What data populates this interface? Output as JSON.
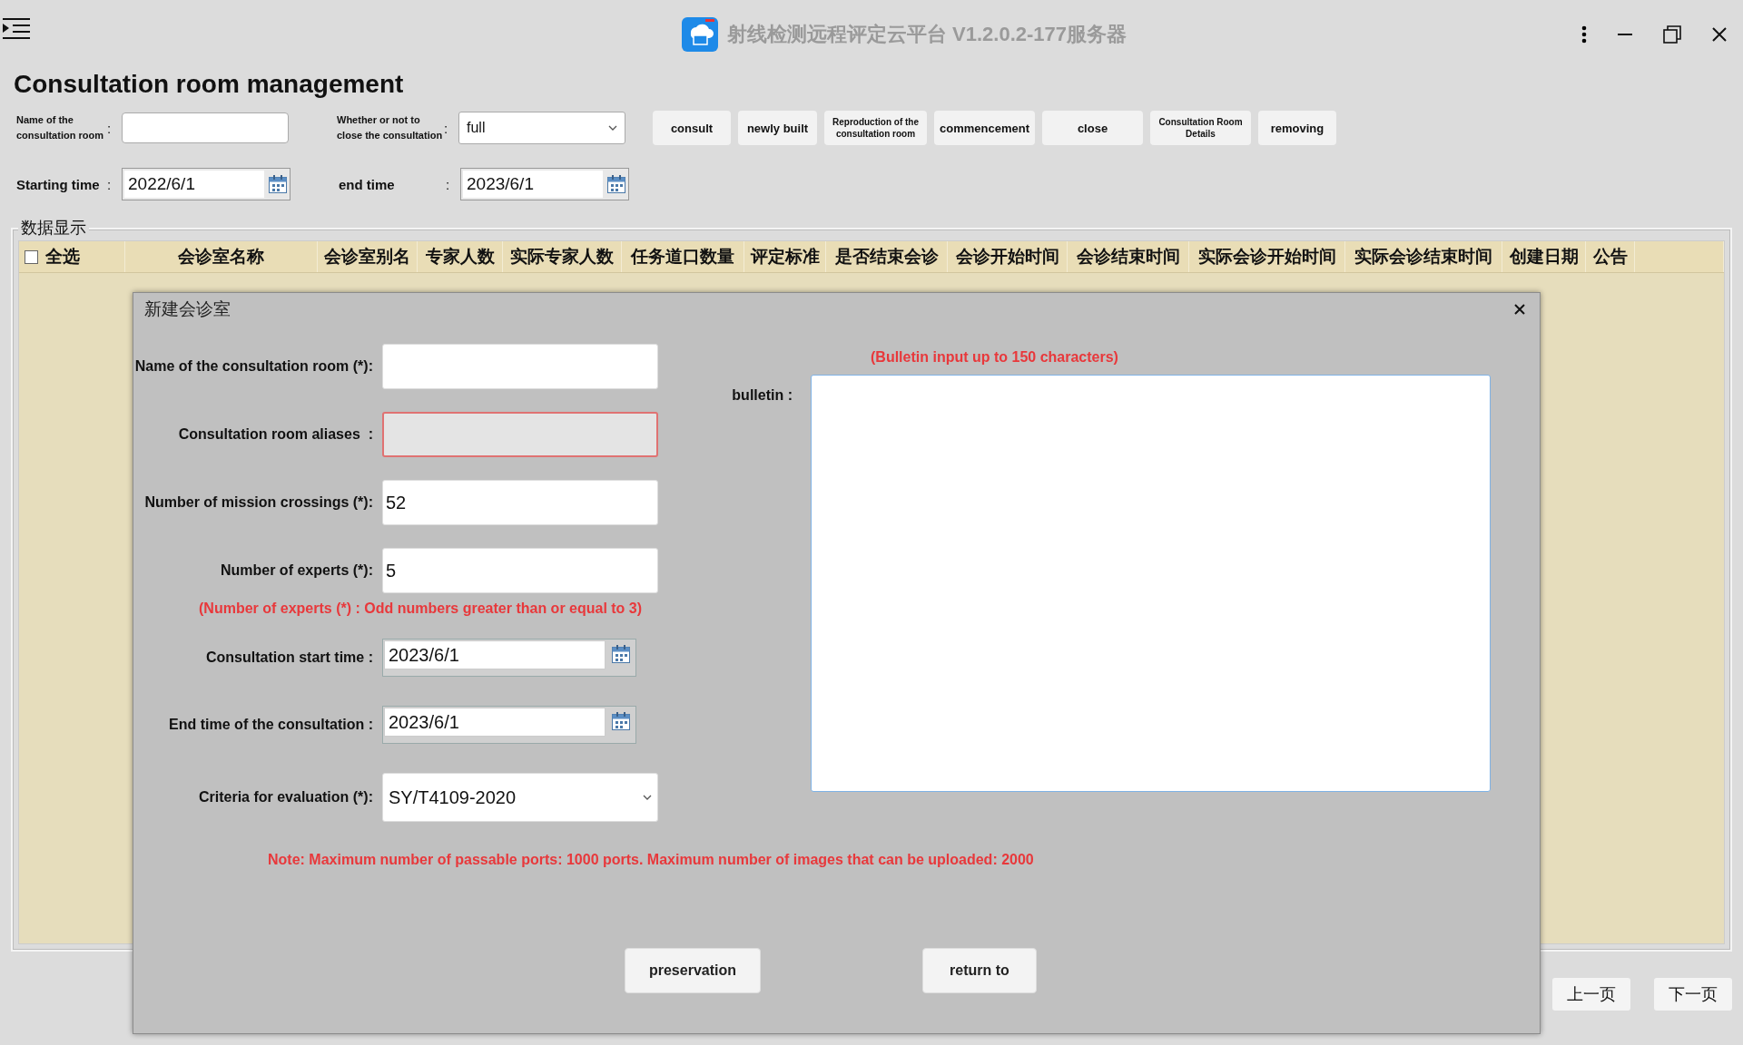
{
  "window": {
    "title": "射线检测远程评定云平台 V1.2.0.2-177服务器"
  },
  "page": {
    "title": "Consultation room management"
  },
  "filters": [
    {
      "kind": "text",
      "label": "Name of the consultation room",
      "sep": ":"
    },
    {
      "kind": "select",
      "label": "Whether or not to close the consultation",
      "sep": ":",
      "value": "full"
    },
    {
      "kind": "date",
      "label": "Starting time",
      "sep": ":",
      "value": "2022/6/1"
    },
    {
      "kind": "date",
      "label": "end time",
      "sep": ":",
      "value": "2023/6/1"
    }
  ],
  "toolbar": [
    "consult",
    "newly built",
    "Reproduction of the consultation room",
    "commencement",
    "close",
    "Consultation Room Details",
    "removing"
  ],
  "table": {
    "group_title": "数据显示",
    "select_all": {
      "label": "全选",
      "checked": false
    },
    "columns": [
      "会诊室名称",
      "会诊室别名",
      "专家人数",
      "实际专家人数",
      "任务道口数量",
      "评定标准",
      "是否结束会诊",
      "会诊开始时间",
      "会诊结束时间",
      "实际会诊开始时间",
      "实际会诊结束时间",
      "创建日期",
      "公告"
    ]
  },
  "dialog": {
    "title": "新建会诊室",
    "fields": [
      {
        "kind": "text",
        "label": "Name of the consultation room (*):",
        "invalid": false
      },
      {
        "kind": "text",
        "label": "Consultation room aliases  :",
        "invalid": true
      },
      {
        "kind": "text",
        "label": "Number of mission crossings (*):",
        "value": "52",
        "invalid": false
      },
      {
        "kind": "text",
        "label": "Number of experts (*):",
        "value": "5",
        "invalid": false,
        "hint": "(Number of experts (*) : Odd numbers greater than or equal to 3)"
      },
      {
        "kind": "date",
        "label": "Consultation start time :",
        "value": "2023/6/1",
        "invalid": false
      },
      {
        "kind": "date",
        "label": "End time of the consultation :",
        "value": "2023/6/1",
        "invalid": false
      },
      {
        "kind": "select",
        "label": "Criteria for evaluation (*):",
        "value": "SY/T4109-2020",
        "invalid": false
      }
    ],
    "bulletin": {
      "label": "bulletin :",
      "hint": "(Bulletin input up to 150 characters)"
    },
    "note": "Note: Maximum number of passable ports: 1000 ports. Maximum number of images that can be uploaded: 2000",
    "buttons": [
      "preservation",
      "return to"
    ]
  },
  "pager": [
    "上一页",
    "下一页"
  ]
}
